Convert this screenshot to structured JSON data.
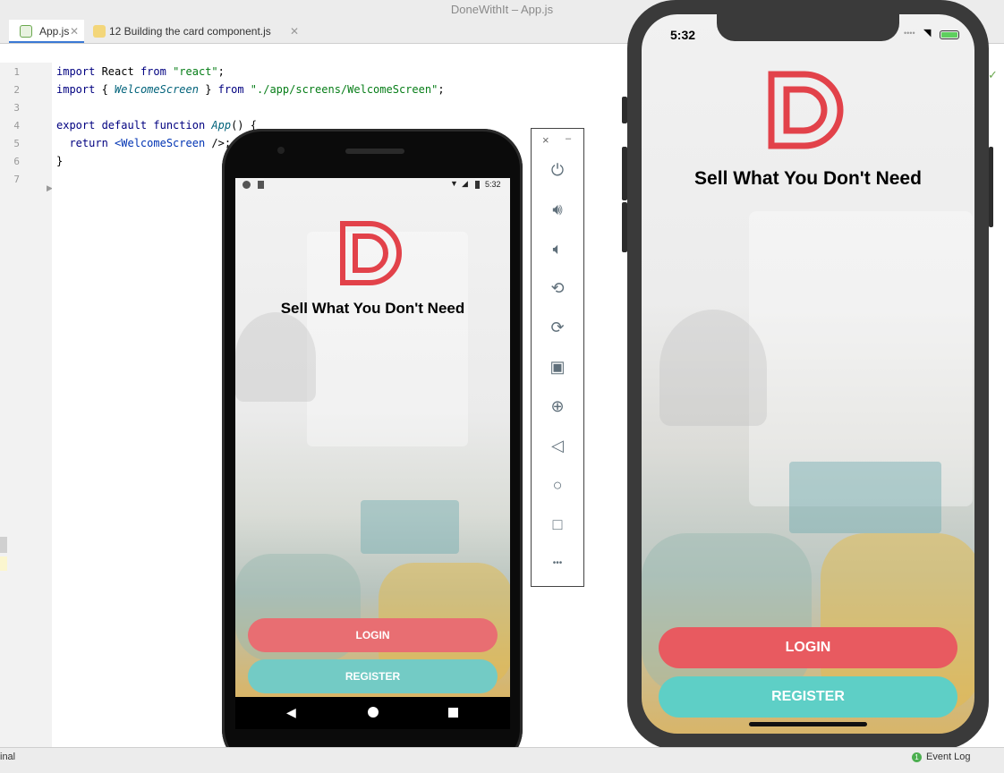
{
  "window": {
    "title": "DoneWithIt – App.js"
  },
  "tabs": [
    {
      "label": "App.js"
    },
    {
      "label": "12 Building the card component.js"
    }
  ],
  "editor": {
    "line_numbers": [
      "1",
      "2",
      "3",
      "4",
      "5",
      "6",
      "7"
    ],
    "lines": {
      "l1": {
        "a": "import",
        "b": " React ",
        "c": "from",
        "d": " \"react\"",
        "e": ";"
      },
      "l2": {
        "a": "import",
        "b": " { ",
        "c": "WelcomeScreen",
        "d": " } ",
        "e": "from",
        "f": " \"./app/screens/WelcomeScreen\"",
        "g": ";"
      },
      "l4": {
        "a": "export default function",
        "b": " App",
        "c": "() {"
      },
      "l5": {
        "a": "  return ",
        "b": "<WelcomeScreen",
        "c": " />;"
      },
      "l6": {
        "a": "}"
      }
    }
  },
  "android": {
    "time": "5:32",
    "tagline": "Sell What You Don't Need",
    "login_label": "LOGIN",
    "register_label": "REGISTER"
  },
  "ios": {
    "time": "5:32",
    "tagline": "Sell What You Don't Need",
    "login_label": "LOGIN",
    "register_label": "REGISTER"
  },
  "emulator_toolbar": {
    "close_glyph": "×",
    "minimize_glyph": "–",
    "more_glyph": "•••"
  },
  "statusbar": {
    "left_label": "inal",
    "event_log_count": "1",
    "event_log_label": "Event Log"
  },
  "colors": {
    "primary": "#e85a60",
    "secondary": "#5ecfc6",
    "logo": "#e2424a"
  }
}
